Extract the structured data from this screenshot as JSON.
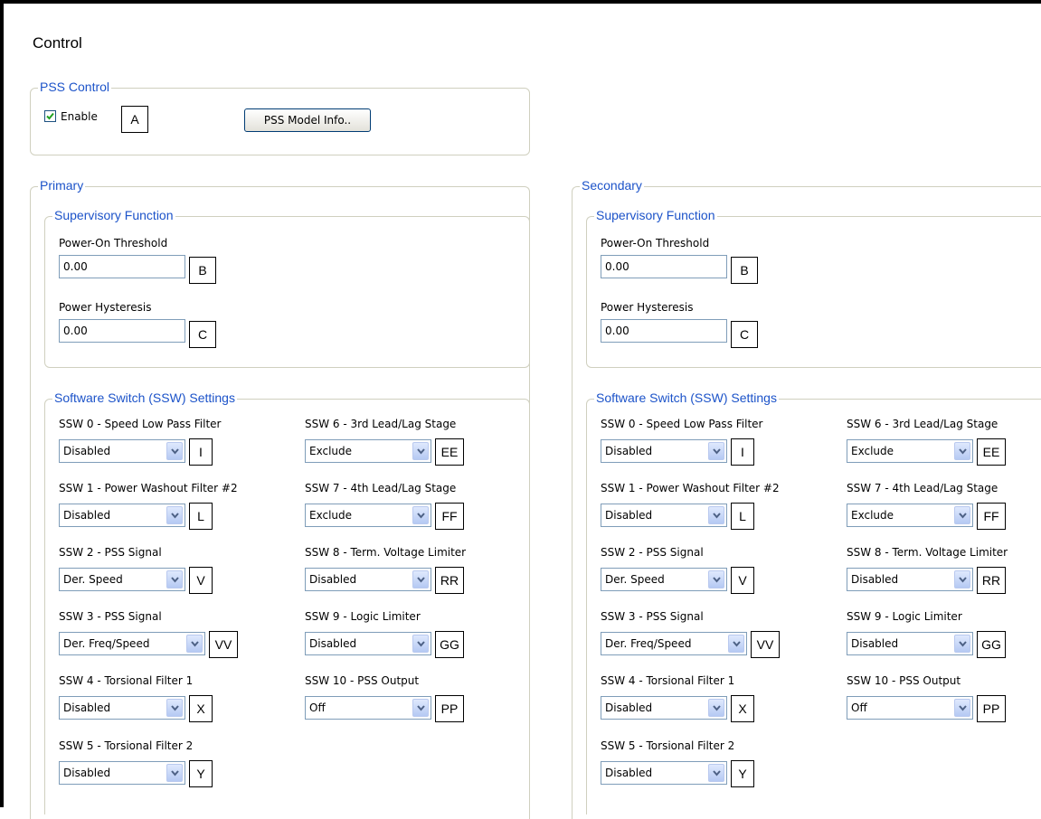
{
  "page_title": "Control",
  "pss_control": {
    "legend": "PSS Control",
    "enable_label": "Enable",
    "enable_checked": true,
    "enable_tag": "A",
    "model_info_button": "PSS Model Info.."
  },
  "primary": {
    "legend": "Primary",
    "supervisory": {
      "legend": "Supervisory Function",
      "power_on_label": "Power-On Threshold",
      "power_on_value": "0.00",
      "power_on_tag": "B",
      "hysteresis_label": "Power Hysteresis",
      "hysteresis_value": "0.00",
      "hysteresis_tag": "C"
    },
    "ssw": {
      "legend": "Software Switch (SSW) Settings",
      "items": [
        {
          "label": "SSW 0 - Speed Low Pass Filter",
          "value": "Disabled",
          "tag": "I"
        },
        {
          "label": "SSW 1 - Power Washout Filter #2",
          "value": "Disabled",
          "tag": "L"
        },
        {
          "label": "SSW 2 - PSS Signal",
          "value": "Der. Speed",
          "tag": "V"
        },
        {
          "label": "SSW 3 - PSS Signal",
          "value": "Der. Freq/Speed",
          "tag": "VV"
        },
        {
          "label": "SSW 4 - Torsional Filter 1",
          "value": "Disabled",
          "tag": "X"
        },
        {
          "label": "SSW 5 - Torsional Filter 2",
          "value": "Disabled",
          "tag": "Y"
        },
        {
          "label": "SSW 6 - 3rd Lead/Lag Stage",
          "value": "Exclude",
          "tag": "EE"
        },
        {
          "label": "SSW 7 - 4th Lead/Lag Stage",
          "value": "Exclude",
          "tag": "FF"
        },
        {
          "label": "SSW 8 - Term. Voltage Limiter",
          "value": "Disabled",
          "tag": "RR"
        },
        {
          "label": "SSW 9 - Logic Limiter",
          "value": "Disabled",
          "tag": "GG"
        },
        {
          "label": "SSW 10 - PSS Output",
          "value": "Off",
          "tag": "PP"
        }
      ]
    }
  },
  "secondary": {
    "legend": "Secondary",
    "supervisory": {
      "legend": "Supervisory Function",
      "power_on_label": "Power-On Threshold",
      "power_on_value": "0.00",
      "power_on_tag": "B",
      "hysteresis_label": "Power Hysteresis",
      "hysteresis_value": "0.00",
      "hysteresis_tag": "C"
    },
    "ssw": {
      "legend": "Software Switch (SSW) Settings",
      "items": [
        {
          "label": "SSW 0 - Speed Low Pass Filter",
          "value": "Disabled",
          "tag": "I"
        },
        {
          "label": "SSW 1 - Power Washout Filter #2",
          "value": "Disabled",
          "tag": "L"
        },
        {
          "label": "SSW 2 - PSS Signal",
          "value": "Der. Speed",
          "tag": "V"
        },
        {
          "label": "SSW 3 - PSS Signal",
          "value": "Der. Freq/Speed",
          "tag": "VV"
        },
        {
          "label": "SSW 4 - Torsional Filter 1",
          "value": "Disabled",
          "tag": "X"
        },
        {
          "label": "SSW 5 - Torsional Filter 2",
          "value": "Disabled",
          "tag": "Y"
        },
        {
          "label": "SSW 6 - 3rd Lead/Lag Stage",
          "value": "Exclude",
          "tag": "EE"
        },
        {
          "label": "SSW 7 - 4th Lead/Lag Stage",
          "value": "Exclude",
          "tag": "FF"
        },
        {
          "label": "SSW 8 - Term. Voltage Limiter",
          "value": "Disabled",
          "tag": "RR"
        },
        {
          "label": "SSW 9 - Logic Limiter",
          "value": "Disabled",
          "tag": "GG"
        },
        {
          "label": "SSW 10 - PSS Output",
          "value": "Off",
          "tag": "PP"
        }
      ]
    }
  },
  "colors": {
    "legend_text": "#1c53c9",
    "group_border": "#d0d0bf",
    "field_border": "#7f9db9",
    "check_mark": "#21a121"
  },
  "icons": {
    "dropdown": "chevron-down-icon",
    "checkbox": "checkmark-icon"
  }
}
